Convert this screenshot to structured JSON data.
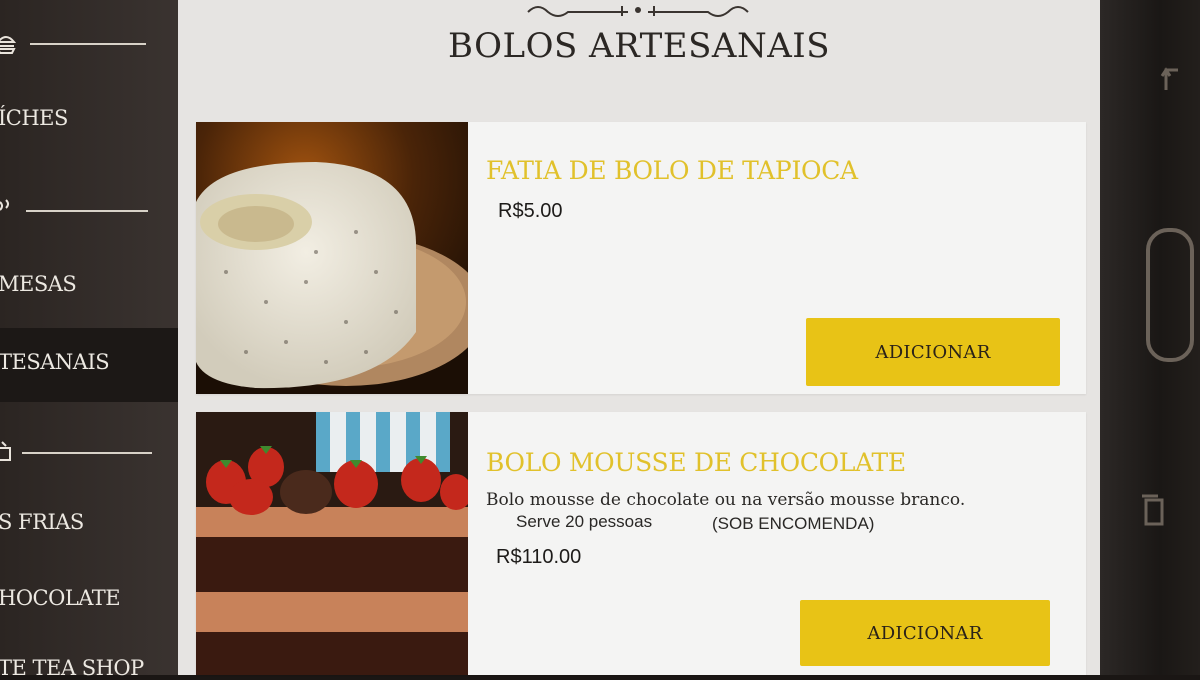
{
  "sidebar": {
    "items": [
      {
        "label": "ÍCHES"
      },
      {
        "label": "MESAS"
      },
      {
        "label": "TESANAIS"
      },
      {
        "label": "S FRIAS"
      },
      {
        "label": "HOCOLATE"
      },
      {
        "label": "TE TEA SHOP"
      }
    ],
    "active_index": 2
  },
  "page": {
    "title": "BOLOS ARTESANAIS"
  },
  "products": [
    {
      "name": "FATIA DE BOLO DE TAPIOCA",
      "price": "R$5.00",
      "button_label": "ADICIONAR",
      "image": "tapioca-cake"
    },
    {
      "name": "BOLO MOUSSE DE CHOCOLATE",
      "description": "Bolo mousse de chocolate ou na versão mousse branco.",
      "serves": "Serve 20 pessoas",
      "note": "(SOB ENCOMENDA)",
      "price": "R$110.00",
      "button_label": "ADICIONAR",
      "image": "chocolate-mousse-cake"
    }
  ],
  "colors": {
    "accent": "#e8c316",
    "item_name": "#e1c12b",
    "sidebar_bg": "#2b2522",
    "content_bg": "#e6e4e2"
  }
}
